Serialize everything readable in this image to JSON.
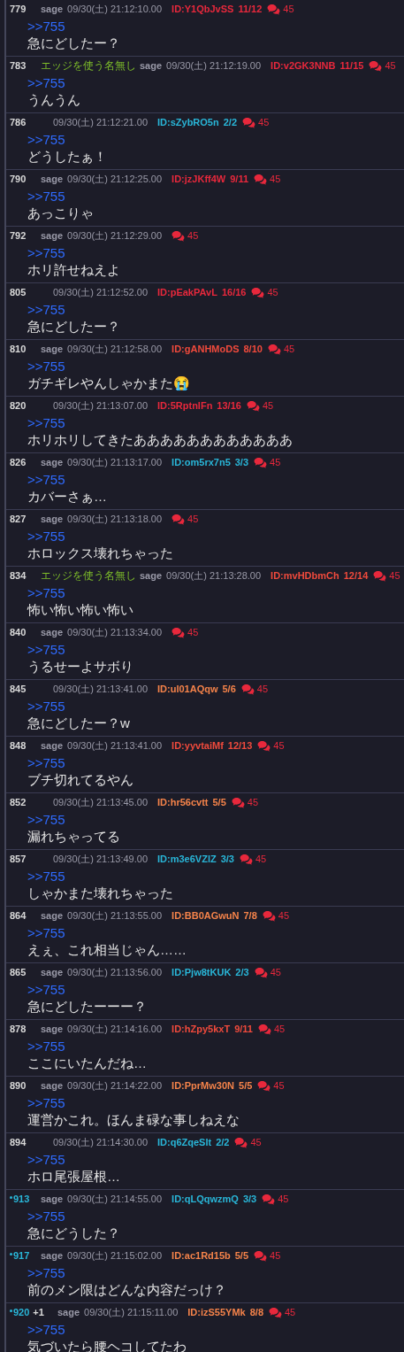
{
  "posts": [
    {
      "number": "779",
      "marked": false,
      "sage": "sage",
      "date": "09/30(土) 21:12:10.00",
      "id": "ID:Y1QbJvSS",
      "color": "#e8283c",
      "count": "11/12",
      "replies": "45",
      "anchor": ">>755",
      "text": "急にどしたー？"
    },
    {
      "number": "783",
      "marked": false,
      "name": "エッジを使う名無し",
      "sage": "sage",
      "date": "09/30(土) 21:12:19.00",
      "id": "ID:v2GK3NNB",
      "color": "#e8283c",
      "count": "11/15",
      "replies": "45",
      "anchor": ">>755",
      "text": "うんうん"
    },
    {
      "number": "786",
      "marked": false,
      "date": "09/30(土) 21:12:21.00",
      "id": "ID:sZybRO5n",
      "color": "#29b6d8",
      "count": "2/2",
      "replies": "45",
      "anchor": ">>755",
      "text": "どうしたぁ！"
    },
    {
      "number": "790",
      "marked": false,
      "sage": "sage",
      "date": "09/30(土) 21:12:25.00",
      "id": "ID:jzJKff4W",
      "color": "#e8283c",
      "count": "9/11",
      "replies": "45",
      "anchor": ">>755",
      "text": "あっこりゃ"
    },
    {
      "number": "792",
      "marked": false,
      "sage": "sage",
      "date": "09/30(土) 21:12:29.00",
      "replies": "45",
      "anchor": ">>755",
      "text": "ホリ許せねえよ"
    },
    {
      "number": "805",
      "marked": false,
      "date": "09/30(土) 21:12:52.00",
      "id": "ID:pEakPAvL",
      "color": "#e8283c",
      "count": "16/16",
      "replies": "45",
      "anchor": ">>755",
      "text": "急にどしたー？"
    },
    {
      "number": "810",
      "marked": false,
      "sage": "sage",
      "date": "09/30(土) 21:12:58.00",
      "id": "ID:gANHMoDS",
      "color": "#f04a3c",
      "count": "8/10",
      "replies": "45",
      "anchor": ">>755",
      "text": "ガチギレやんしゃかまた😭"
    },
    {
      "number": "820",
      "marked": false,
      "date": "09/30(土) 21:13:07.00",
      "id": "ID:5RptnlFn",
      "color": "#e8283c",
      "count": "13/16",
      "replies": "45",
      "anchor": ">>755",
      "text": "ホリホリしてきたああああああああああああ"
    },
    {
      "number": "826",
      "marked": false,
      "sage": "sage",
      "date": "09/30(土) 21:13:17.00",
      "id": "ID:om5rx7n5",
      "color": "#29b6d8",
      "count": "3/3",
      "replies": "45",
      "anchor": ">>755",
      "text": "カバーさぁ…"
    },
    {
      "number": "827",
      "marked": false,
      "sage": "sage",
      "date": "09/30(土) 21:13:18.00",
      "replies": "45",
      "anchor": ">>755",
      "text": "ホロックス壊れちゃった"
    },
    {
      "number": "834",
      "marked": false,
      "name": "エッジを使う名無し",
      "sage": "sage",
      "date": "09/30(土) 21:13:28.00",
      "id": "ID:mvHDbmCh",
      "color": "#f04a3c",
      "count": "12/14",
      "replies": "45",
      "anchor": ">>755",
      "text": "怖い怖い怖い怖い"
    },
    {
      "number": "840",
      "marked": false,
      "sage": "sage",
      "date": "09/30(土) 21:13:34.00",
      "replies": "45",
      "anchor": ">>755",
      "text": "うるせーよサボり"
    },
    {
      "number": "845",
      "marked": false,
      "date": "09/30(土) 21:13:41.00",
      "id": "ID:ul01AQqw",
      "color": "#f5834a",
      "count": "5/6",
      "replies": "45",
      "anchor": ">>755",
      "text": "急にどしたー？w"
    },
    {
      "number": "848",
      "marked": false,
      "sage": "sage",
      "date": "09/30(土) 21:13:41.00",
      "id": "ID:yyvtaiMf",
      "color": "#f04a3c",
      "count": "12/13",
      "replies": "45",
      "anchor": ">>755",
      "text": "ブチ切れてるやん"
    },
    {
      "number": "852",
      "marked": false,
      "date": "09/30(土) 21:13:45.00",
      "id": "ID:hr56cvtt",
      "color": "#f5834a",
      "count": "5/5",
      "replies": "45",
      "anchor": ">>755",
      "text": "漏れちゃってる"
    },
    {
      "number": "857",
      "marked": false,
      "date": "09/30(土) 21:13:49.00",
      "id": "ID:m3e6VZlZ",
      "color": "#29b6d8",
      "count": "3/3",
      "replies": "45",
      "anchor": ">>755",
      "text": "しゃかまた壊れちゃった"
    },
    {
      "number": "864",
      "marked": false,
      "sage": "sage",
      "date": "09/30(土) 21:13:55.00",
      "id": "ID:BB0AGwuN",
      "color": "#f5834a",
      "count": "7/8",
      "replies": "45",
      "anchor": ">>755",
      "text": "えぇ、これ相当じゃん……"
    },
    {
      "number": "865",
      "marked": false,
      "sage": "sage",
      "date": "09/30(土) 21:13:56.00",
      "id": "ID:Pjw8tKUK",
      "color": "#29b6d8",
      "count": "2/3",
      "replies": "45",
      "anchor": ">>755",
      "text": "急にどしたーーー？"
    },
    {
      "number": "878",
      "marked": false,
      "sage": "sage",
      "date": "09/30(土) 21:14:16.00",
      "id": "ID:hZpy5kxT",
      "color": "#f04a3c",
      "count": "9/11",
      "replies": "45",
      "anchor": ">>755",
      "text": "ここにいたんだね…"
    },
    {
      "number": "890",
      "marked": false,
      "sage": "sage",
      "date": "09/30(土) 21:14:22.00",
      "id": "ID:PprMw30N",
      "color": "#f5834a",
      "count": "5/5",
      "replies": "45",
      "anchor": ">>755",
      "text": "運営かこれ。ほんま碌な事しねえな"
    },
    {
      "number": "894",
      "marked": false,
      "date": "09/30(土) 21:14:30.00",
      "id": "ID:q6ZqeSlt",
      "color": "#29b6d8",
      "count": "2/2",
      "replies": "45",
      "anchor": ">>755",
      "text": "ホロ尾張屋根…"
    },
    {
      "number": "913",
      "marked": true,
      "sage": "sage",
      "date": "09/30(土) 21:14:55.00",
      "id": "ID:qLQqwzmQ",
      "color": "#29b6d8",
      "count": "3/3",
      "replies": "45",
      "anchor": ">>755",
      "text": "急にどうした？"
    },
    {
      "number": "917",
      "marked": true,
      "sage": "sage",
      "date": "09/30(土) 21:15:02.00",
      "id": "ID:ac1Rd15b",
      "color": "#f5834a",
      "count": "5/5",
      "replies": "45",
      "anchor": ">>755",
      "text": "前のメン限はどんな内容だっけ？"
    },
    {
      "number": "920",
      "marked": true,
      "plus": "+1",
      "sage": "sage",
      "date": "09/30(土) 21:15:11.00",
      "id": "ID:izS55YMk",
      "color": "#f5834a",
      "count": "8/8",
      "replies": "45",
      "anchor": ">>755",
      "text": "気づいたら腰ヘコしてたわ"
    }
  ]
}
